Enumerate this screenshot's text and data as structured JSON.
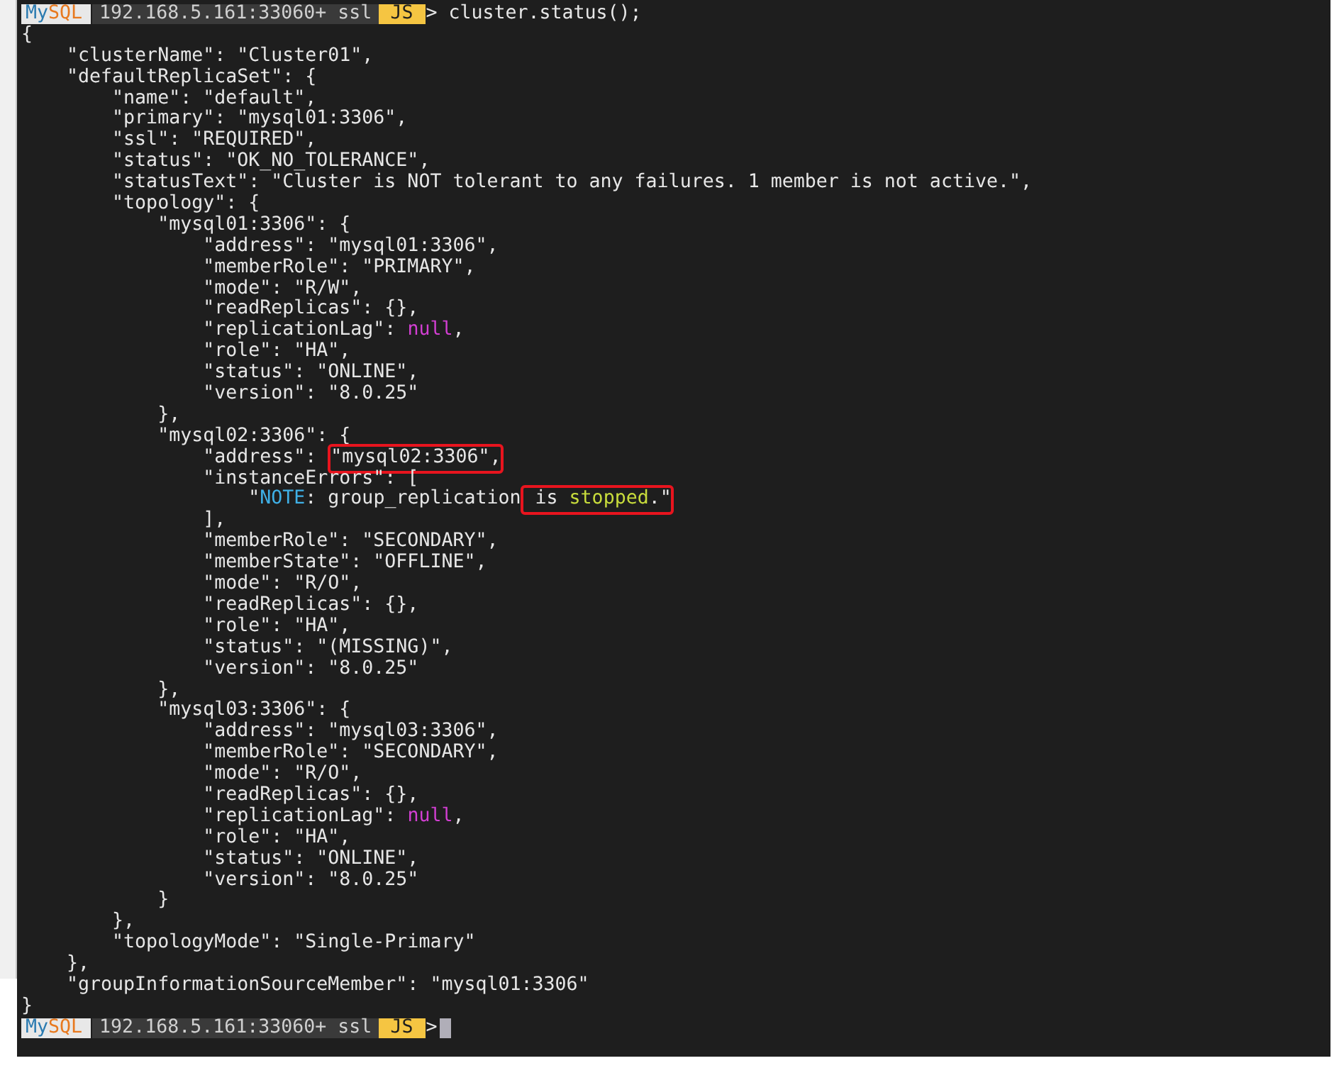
{
  "terminal": {
    "lines": [
      {
        "kind": "prompt",
        "product_parts": [
          "My",
          "SQL"
        ],
        "host": "192.168.5.161:33060+ ssl",
        "mode": "JS",
        "arrow": ">",
        "command": "cluster.status();",
        "cursor": false
      },
      {
        "kind": "output",
        "segments": [
          {
            "kind": "text",
            "text": "{"
          }
        ]
      },
      {
        "kind": "output",
        "segments": [
          {
            "kind": "text",
            "text": "    \"clusterName\": \"Cluster01\","
          }
        ]
      },
      {
        "kind": "output",
        "segments": [
          {
            "kind": "text",
            "text": "    \"defaultReplicaSet\": {"
          }
        ]
      },
      {
        "kind": "output",
        "segments": [
          {
            "kind": "text",
            "text": "        \"name\": \"default\","
          }
        ]
      },
      {
        "kind": "output",
        "segments": [
          {
            "kind": "text",
            "text": "        \"primary\": \"mysql01:3306\","
          }
        ]
      },
      {
        "kind": "output",
        "segments": [
          {
            "kind": "text",
            "text": "        \"ssl\": \"REQUIRED\","
          }
        ]
      },
      {
        "kind": "output",
        "segments": [
          {
            "kind": "text",
            "text": "        \"status\": \"OK_NO_TOLERANCE\","
          }
        ]
      },
      {
        "kind": "output",
        "segments": [
          {
            "kind": "text",
            "text": "        \"statusText\": \"Cluster is NOT tolerant to any failures. 1 member is not active.\","
          }
        ]
      },
      {
        "kind": "output",
        "segments": [
          {
            "kind": "text",
            "text": "        \"topology\": {"
          }
        ]
      },
      {
        "kind": "output",
        "segments": [
          {
            "kind": "text",
            "text": "            \"mysql01:3306\": {"
          }
        ]
      },
      {
        "kind": "output",
        "segments": [
          {
            "kind": "text",
            "text": "                \"address\": \"mysql01:3306\","
          }
        ]
      },
      {
        "kind": "output",
        "segments": [
          {
            "kind": "text",
            "text": "                \"memberRole\": \"PRIMARY\","
          }
        ]
      },
      {
        "kind": "output",
        "segments": [
          {
            "kind": "text",
            "text": "                \"mode\": \"R/W\","
          }
        ]
      },
      {
        "kind": "output",
        "segments": [
          {
            "kind": "text",
            "text": "                \"readReplicas\": {},"
          }
        ]
      },
      {
        "kind": "output",
        "segments": [
          {
            "kind": "text",
            "text": "                \"replicationLag\": "
          },
          {
            "kind": "null",
            "text": "null"
          },
          {
            "kind": "text",
            "text": ","
          }
        ]
      },
      {
        "kind": "output",
        "segments": [
          {
            "kind": "text",
            "text": "                \"role\": \"HA\","
          }
        ]
      },
      {
        "kind": "output",
        "segments": [
          {
            "kind": "text",
            "text": "                \"status\": \"ONLINE\","
          }
        ]
      },
      {
        "kind": "output",
        "segments": [
          {
            "kind": "text",
            "text": "                \"version\": \"8.0.25\""
          }
        ]
      },
      {
        "kind": "output",
        "segments": [
          {
            "kind": "text",
            "text": "            },"
          }
        ]
      },
      {
        "kind": "output",
        "segments": [
          {
            "kind": "text",
            "text": "            \"mysql02:3306\": {"
          }
        ]
      },
      {
        "kind": "output",
        "segments": [
          {
            "kind": "text",
            "text": "                \"address\": "
          },
          {
            "kind": "box",
            "parts": [
              {
                "kind": "text",
                "text": "\"mysql02:3306\","
              }
            ]
          }
        ]
      },
      {
        "kind": "output",
        "segments": [
          {
            "kind": "text",
            "text": "                \"instanceErrors\": ["
          }
        ]
      },
      {
        "kind": "output",
        "segments": [
          {
            "kind": "text",
            "text": "                    \""
          },
          {
            "kind": "note",
            "text": "NOTE"
          },
          {
            "kind": "text",
            "text": ": group_replication"
          },
          {
            "kind": "box",
            "parts": [
              {
                "kind": "text",
                "text": " is "
              },
              {
                "kind": "warn",
                "text": "stopped"
              },
              {
                "kind": "text",
                "text": ".\""
              }
            ]
          }
        ]
      },
      {
        "kind": "output",
        "segments": [
          {
            "kind": "text",
            "text": "                ],"
          }
        ]
      },
      {
        "kind": "output",
        "segments": [
          {
            "kind": "text",
            "text": "                \"memberRole\": \"SECONDARY\","
          }
        ]
      },
      {
        "kind": "output",
        "segments": [
          {
            "kind": "text",
            "text": "                \"memberState\": \"OFFLINE\","
          }
        ]
      },
      {
        "kind": "output",
        "segments": [
          {
            "kind": "text",
            "text": "                \"mode\": \"R/O\","
          }
        ]
      },
      {
        "kind": "output",
        "segments": [
          {
            "kind": "text",
            "text": "                \"readReplicas\": {},"
          }
        ]
      },
      {
        "kind": "output",
        "segments": [
          {
            "kind": "text",
            "text": "                \"role\": \"HA\","
          }
        ]
      },
      {
        "kind": "output",
        "segments": [
          {
            "kind": "text",
            "text": "                \"status\": \"(MISSING)\","
          }
        ]
      },
      {
        "kind": "output",
        "segments": [
          {
            "kind": "text",
            "text": "                \"version\": \"8.0.25\""
          }
        ]
      },
      {
        "kind": "output",
        "segments": [
          {
            "kind": "text",
            "text": "            },"
          }
        ]
      },
      {
        "kind": "output",
        "segments": [
          {
            "kind": "text",
            "text": "            \"mysql03:3306\": {"
          }
        ]
      },
      {
        "kind": "output",
        "segments": [
          {
            "kind": "text",
            "text": "                \"address\": \"mysql03:3306\","
          }
        ]
      },
      {
        "kind": "output",
        "segments": [
          {
            "kind": "text",
            "text": "                \"memberRole\": \"SECONDARY\","
          }
        ]
      },
      {
        "kind": "output",
        "segments": [
          {
            "kind": "text",
            "text": "                \"mode\": \"R/O\","
          }
        ]
      },
      {
        "kind": "output",
        "segments": [
          {
            "kind": "text",
            "text": "                \"readReplicas\": {},"
          }
        ]
      },
      {
        "kind": "output",
        "segments": [
          {
            "kind": "text",
            "text": "                \"replicationLag\": "
          },
          {
            "kind": "null",
            "text": "null"
          },
          {
            "kind": "text",
            "text": ","
          }
        ]
      },
      {
        "kind": "output",
        "segments": [
          {
            "kind": "text",
            "text": "                \"role\": \"HA\","
          }
        ]
      },
      {
        "kind": "output",
        "segments": [
          {
            "kind": "text",
            "text": "                \"status\": \"ONLINE\","
          }
        ]
      },
      {
        "kind": "output",
        "segments": [
          {
            "kind": "text",
            "text": "                \"version\": \"8.0.25\""
          }
        ]
      },
      {
        "kind": "output",
        "segments": [
          {
            "kind": "text",
            "text": "            }"
          }
        ]
      },
      {
        "kind": "output",
        "segments": [
          {
            "kind": "text",
            "text": "        },"
          }
        ]
      },
      {
        "kind": "output",
        "segments": [
          {
            "kind": "text",
            "text": "        \"topologyMode\": \"Single-Primary\""
          }
        ]
      },
      {
        "kind": "output",
        "segments": [
          {
            "kind": "text",
            "text": "    },"
          }
        ]
      },
      {
        "kind": "output",
        "segments": [
          {
            "kind": "text",
            "text": "    \"groupInformationSourceMember\": \"mysql01:3306\""
          }
        ]
      },
      {
        "kind": "output",
        "segments": [
          {
            "kind": "text",
            "text": "}"
          }
        ]
      },
      {
        "kind": "prompt",
        "product_parts": [
          "My",
          "SQL"
        ],
        "host": "192.168.5.161:33060+ ssl",
        "mode": "JS",
        "arrow": ">",
        "cursor": true
      }
    ]
  }
}
